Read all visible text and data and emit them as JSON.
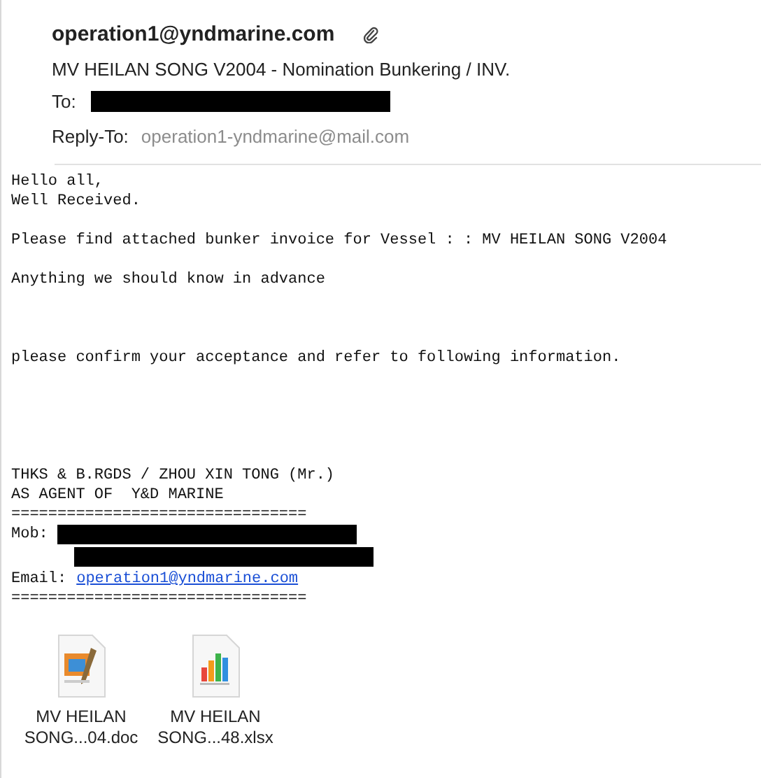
{
  "header": {
    "sender": "operation1@yndmarine.com",
    "has_attachment": true,
    "subject": "MV HEILAN SONG V2004 - Nomination Bunkering / INV.",
    "to_label": "To:",
    "reply_to_label": "Reply-To:",
    "reply_to": "operation1-yndmarine@mail.com"
  },
  "body": {
    "paragraphs": [
      {
        "lines": [
          "Hello all,",
          "Well Received."
        ]
      },
      {
        "lines": [
          "Please find attached bunker invoice for Vessel : : MV HEILAN SONG V2004"
        ]
      },
      {
        "lines": [
          "Anything we should know in advance"
        ]
      },
      {
        "lines": [
          "please confirm your acceptance and refer to following information."
        ]
      }
    ],
    "signature": {
      "lines": [
        "THKS & B.RGDS / ZHOU XIN TONG (Mr.)",
        "AS AGENT OF  Y&D MARINE",
        "================================"
      ],
      "mob_label": "Mob:",
      "email_label": "Email:",
      "email": "operation1@yndmarine.com",
      "rule": "================================"
    }
  },
  "attachments": [
    {
      "kind": "doc",
      "name_line1": "MV HEILAN",
      "name_line2": "SONG...04.doc"
    },
    {
      "kind": "xlsx",
      "name_line1": "MV HEILAN",
      "name_line2": "SONG...48.xlsx"
    }
  ]
}
